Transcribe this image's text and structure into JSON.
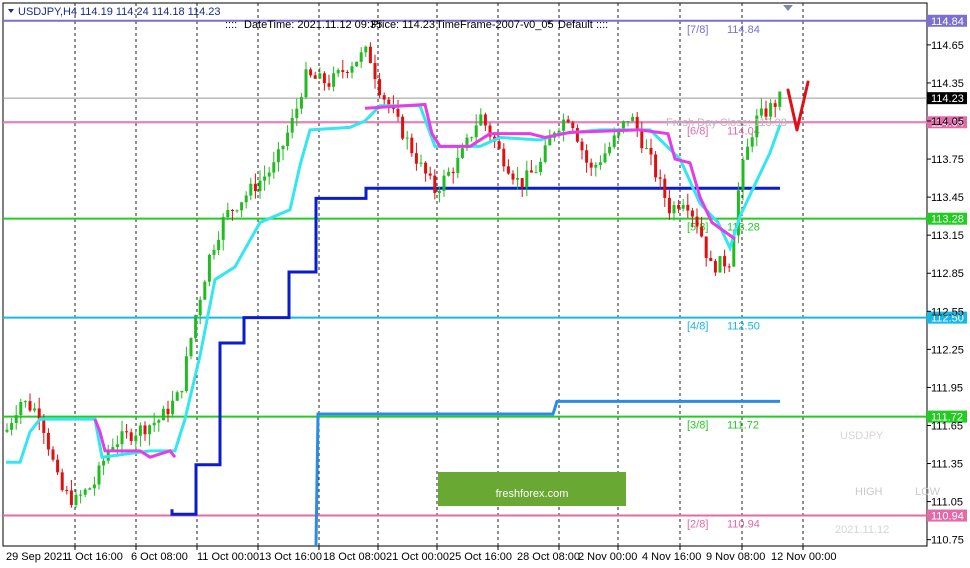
{
  "chart_data": {
    "type": "candlestick",
    "symbol_header": "USDJPY,H4",
    "ohlc_header": "114.19 114.24 114.18 114.23",
    "info": {
      "datetime": "DateTime: 2021.11.12 09:35",
      "price": "Price: 114.23",
      "timeframe": "TimeFrame-2007-v0_05",
      "default": "Default"
    },
    "ylim": [
      110.7,
      114.98
    ],
    "yticks": [
      "114.65",
      "114.35",
      "114.05",
      "113.75",
      "113.45",
      "113.15",
      "112.85",
      "112.55",
      "112.25",
      "111.95",
      "111.65",
      "111.35",
      "111.05",
      "110.75"
    ],
    "xticks": [
      "29 Sep 2021",
      "1 Oct 16:00",
      "6 Oct 08:00",
      "11 Oct 00:00",
      "13 Oct 16:00",
      "18 Oct 08:00",
      "21 Oct 00:00",
      "25 Oct 16:00",
      "28 Oct 08:00",
      "2 Nov 00:00",
      "4 Nov 16:00",
      "9 Nov 08:00",
      "12 Nov 00:00"
    ],
    "current_price": "114.23",
    "murrey_levels": [
      {
        "name": "[7/8]",
        "value": 114.84,
        "label": "114.84",
        "color": "#7b6fd0"
      },
      {
        "name": "[6/8]",
        "value": 114.04,
        "label": "114.04",
        "color": "#e36aa8"
      },
      {
        "name": "[5/8]",
        "value": 113.28,
        "label": "113.28",
        "color": "#22cc22"
      },
      {
        "name": "[4/8]",
        "value": 112.5,
        "label": "112.50",
        "color": "#17b7e6"
      },
      {
        "name": "[3/8]",
        "value": 111.72,
        "label": "111.72",
        "color": "#22cc22"
      },
      {
        "name": "[2/8]",
        "value": 110.94,
        "label": "110.94",
        "color": "#e36aa8"
      }
    ],
    "overlay_text": "Fresh Day Close: 113.98",
    "watermark_symbol": "USDJPY",
    "watermark_high": "HIGH",
    "watermark_low": "LOW",
    "watermark_date": "2021.11.12",
    "brand": "freshforex.com",
    "colors": {
      "bull": "#22bb22",
      "bear": "#dd1111",
      "cyan_ma": "#33e6f0",
      "magenta_ma": "#e63ce6",
      "navy_stop": "#0a1ccc",
      "blue_stop": "#2a8ce6",
      "check_mark": "#e0101a",
      "brand_bg": "#6aa834"
    }
  }
}
